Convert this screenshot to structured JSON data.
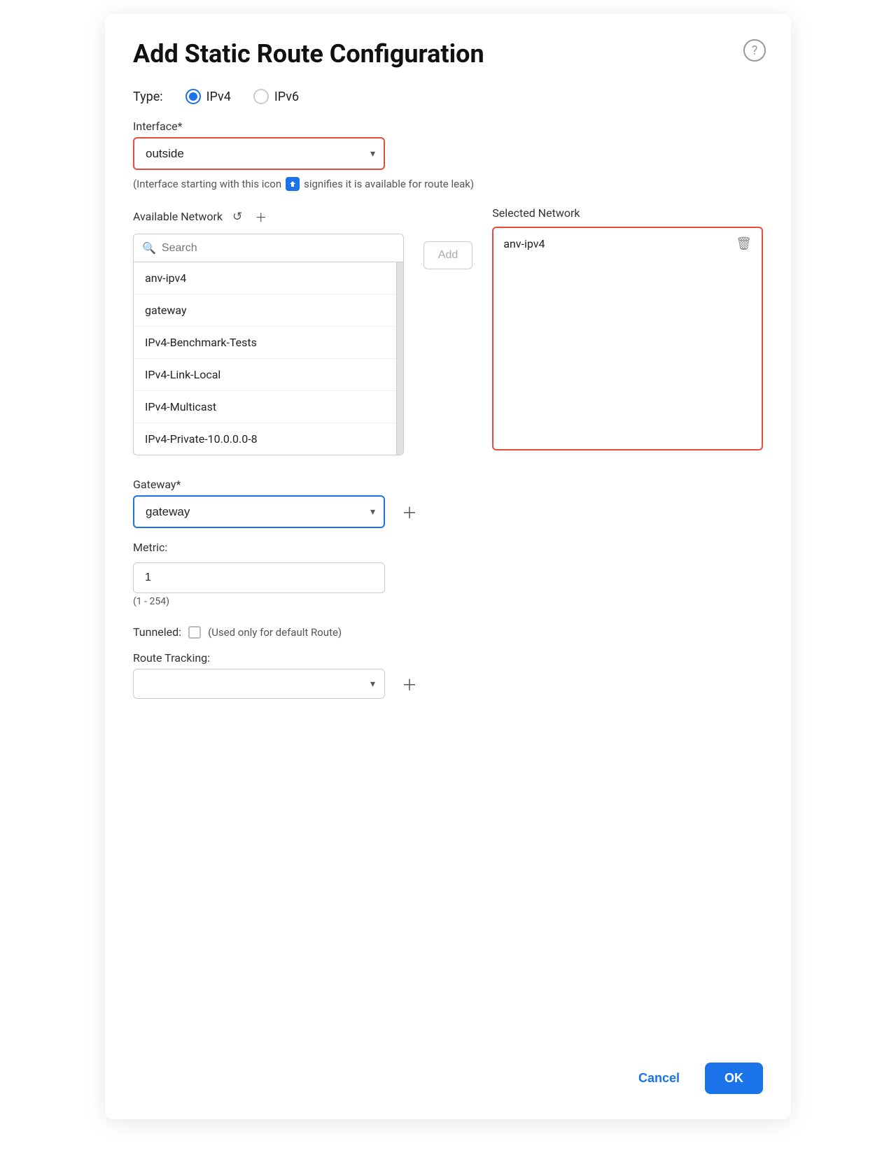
{
  "dialog": {
    "title": "Add Static Route Configuration",
    "help_label": "?"
  },
  "type": {
    "label": "Type:",
    "options": [
      "IPv4",
      "IPv6"
    ],
    "selected": "IPv4"
  },
  "interface": {
    "label": "Interface*",
    "value": "outside",
    "note_prefix": "(Interface starting with this icon",
    "note_suffix": "signifies it is available for route leak)",
    "icon_label": "🔒"
  },
  "available_network": {
    "title": "Available Network",
    "search_placeholder": "Search",
    "items": [
      "anv-ipv4",
      "gateway",
      "IPv4-Benchmark-Tests",
      "IPv4-Link-Local",
      "IPv4-Multicast",
      "IPv4-Private-10.0.0.0-8"
    ]
  },
  "add_button": {
    "label": "Add"
  },
  "selected_network": {
    "title": "Selected Network",
    "items": [
      "anv-ipv4"
    ]
  },
  "gateway": {
    "label": "Gateway*",
    "value": "gateway"
  },
  "metric": {
    "label": "Metric:",
    "value": "1",
    "hint": "(1 - 254)"
  },
  "tunneled": {
    "label": "Tunneled:",
    "note": "(Used only for default Route)"
  },
  "route_tracking": {
    "label": "Route Tracking:",
    "value": ""
  },
  "footer": {
    "cancel_label": "Cancel",
    "ok_label": "OK"
  }
}
